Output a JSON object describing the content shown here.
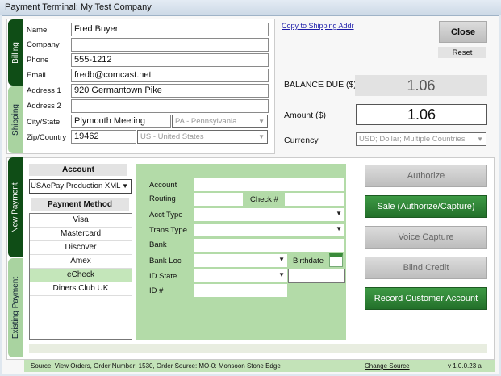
{
  "window": {
    "title": "Payment Terminal:  My Test Company"
  },
  "tabs": {
    "billing": "Billing",
    "shipping": "Shipping",
    "new_payment": "New Payment",
    "existing_payment": "Existing Payment"
  },
  "address": {
    "name_label": "Name",
    "name": "Fred Buyer",
    "company_label": "Company",
    "company": "",
    "phone_label": "Phone",
    "phone": "555-1212",
    "email_label": "Email",
    "email": "fredb@comcast.net",
    "address1_label": "Address 1",
    "address1": "920 Germantown Pike",
    "address2_label": "Address 2",
    "address2": "",
    "citystate_label": "City/State",
    "city": "Plymouth Meeting",
    "state": "PA - Pennsylvania",
    "zipcountry_label": "Zip/Country",
    "zip": "19462",
    "country": "US - United States"
  },
  "copy_link": "Copy to Shipping Addr",
  "close_label": "Close",
  "reset_label": "Reset",
  "balance_label": "BALANCE DUE ($)",
  "balance": "1.06",
  "amount_label": "Amount ($)",
  "amount": "1.06",
  "currency_label": "Currency",
  "currency": "USD; Dollar; Multiple Countries",
  "account_header": "Account",
  "account_select": "USAePay Production XML",
  "method_header": "Payment Method",
  "methods": [
    "Visa",
    "Mastercard",
    "Discover",
    "Amex",
    "eCheck",
    "Diners Club UK"
  ],
  "selected_method": "eCheck",
  "echeck": {
    "account": "Account",
    "routing": "Routing",
    "check": "Check #",
    "acct_type": "Acct Type",
    "trans_type": "Trans Type",
    "bank": "Bank",
    "bank_loc": "Bank Loc",
    "birthdate": "Birthdate",
    "id_state": "ID State",
    "id_num": "ID #"
  },
  "actions": {
    "authorize": "Authorize",
    "sale": "Sale (Authorize/Capture)",
    "voice": "Voice Capture",
    "blind": "Blind Credit",
    "record": "Record Customer Account"
  },
  "status": {
    "source": "Source:  View Orders, Order Number: 1530, Order Source: MO-0:  Monsoon Stone Edge",
    "change_source": "Change Source",
    "version": "v 1.0.0.23  a"
  },
  "colors": {
    "dark_green": "#0f4d16",
    "light_green": "#a9d3a0",
    "form_green": "#b3dba8",
    "selected": "#c4e6ba"
  }
}
